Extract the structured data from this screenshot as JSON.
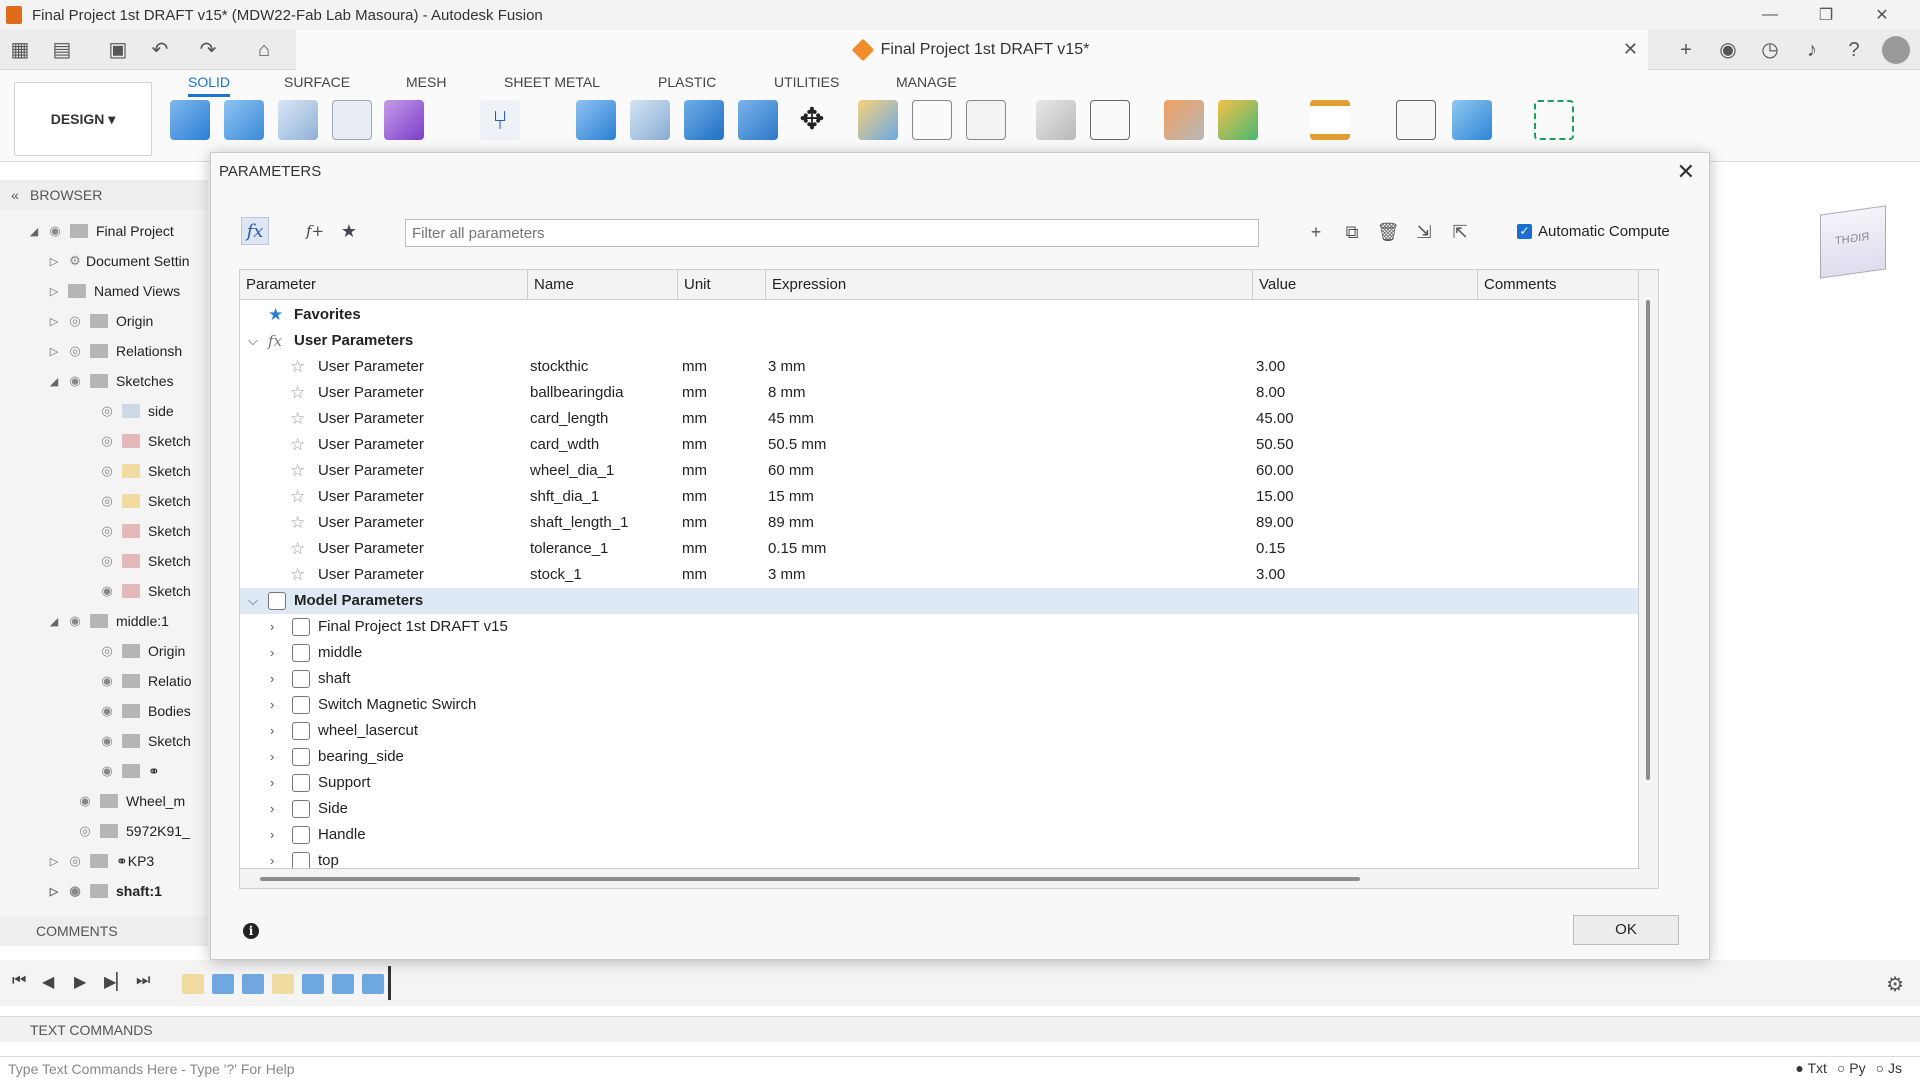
{
  "window": {
    "title": "Final Project 1st DRAFT v15* (MDW22-Fab Lab Masoura) - Autodesk Fusion",
    "controls": [
      "—",
      "❐",
      "✕"
    ]
  },
  "document_tab": {
    "title": "Final Project 1st DRAFT v15*",
    "close": "✕"
  },
  "ribbon": {
    "workspace": "DESIGN ▾",
    "tabs": [
      "SOLID",
      "SURFACE",
      "MESH",
      "SHEET METAL",
      "PLASTIC",
      "UTILITIES",
      "MANAGE"
    ],
    "active_tab": "SOLID"
  },
  "browser": {
    "header": "BROWSER",
    "items": [
      "Final Project",
      "Document Settin",
      "Named Views",
      "Origin",
      "Relationsh",
      "Sketches",
      "side",
      "Sketch",
      "Sketch",
      "Sketch",
      "Sketch",
      "Sketch",
      "Sketch",
      "middle:1",
      "Origin",
      "Relatio",
      "Bodies",
      "Sketch",
      "",
      "Wheel_m",
      "5972K91_",
      "KP3",
      "shaft:1"
    ],
    "comments_label": "COMMENTS"
  },
  "viewcube_label": "RIGHT",
  "text_commands": {
    "label": "TEXT COMMANDS",
    "placeholder": "Type Text Commands Here - Type '?' For Help",
    "modes": [
      "Txt",
      "Py",
      "Js"
    ]
  },
  "parameters_dialog": {
    "title": "PARAMETERS",
    "filter_placeholder": "Filter all parameters",
    "automatic_compute_label": "Automatic Compute",
    "automatic_compute_checked": true,
    "columns": [
      "Parameter",
      "Name",
      "Unit",
      "Expression",
      "Value",
      "Comments"
    ],
    "favorites_label": "Favorites",
    "user_parameters_label": "User Parameters",
    "user_parameters": [
      {
        "parameter": "User Parameter",
        "name": "stockthic",
        "unit": "mm",
        "expression": "3 mm",
        "value": "3.00"
      },
      {
        "parameter": "User Parameter",
        "name": "ballbearingdia",
        "unit": "mm",
        "expression": "8 mm",
        "value": "8.00"
      },
      {
        "parameter": "User Parameter",
        "name": "card_length",
        "unit": "mm",
        "expression": "45 mm",
        "value": "45.00"
      },
      {
        "parameter": "User Parameter",
        "name": "card_wdth",
        "unit": "mm",
        "expression": "50.5 mm",
        "value": "50.50"
      },
      {
        "parameter": "User Parameter",
        "name": "wheel_dia_1",
        "unit": "mm",
        "expression": "60 mm",
        "value": "60.00"
      },
      {
        "parameter": "User Parameter",
        "name": "shft_dia_1",
        "unit": "mm",
        "expression": "15 mm",
        "value": "15.00"
      },
      {
        "parameter": "User Parameter",
        "name": "shaft_length_1",
        "unit": "mm",
        "expression": "89 mm",
        "value": "89.00"
      },
      {
        "parameter": "User Parameter",
        "name": "tolerance_1",
        "unit": "mm",
        "expression": "0.15 mm",
        "value": "0.15"
      },
      {
        "parameter": "User Parameter",
        "name": "stock_1",
        "unit": "mm",
        "expression": "3 mm",
        "value": "3.00"
      }
    ],
    "model_parameters_label": "Model Parameters",
    "model_components": [
      "Final Project 1st DRAFT v15",
      "middle",
      "shaft",
      "Switch Magnetic Swirch",
      "wheel_lasercut",
      "bearing_side",
      "Support",
      "Side",
      "Handle",
      "top"
    ],
    "ok_label": "OK",
    "info_glyph": "i"
  },
  "colors": {
    "accent": "#1a74d2",
    "selected_row": "#dfe9f5"
  }
}
